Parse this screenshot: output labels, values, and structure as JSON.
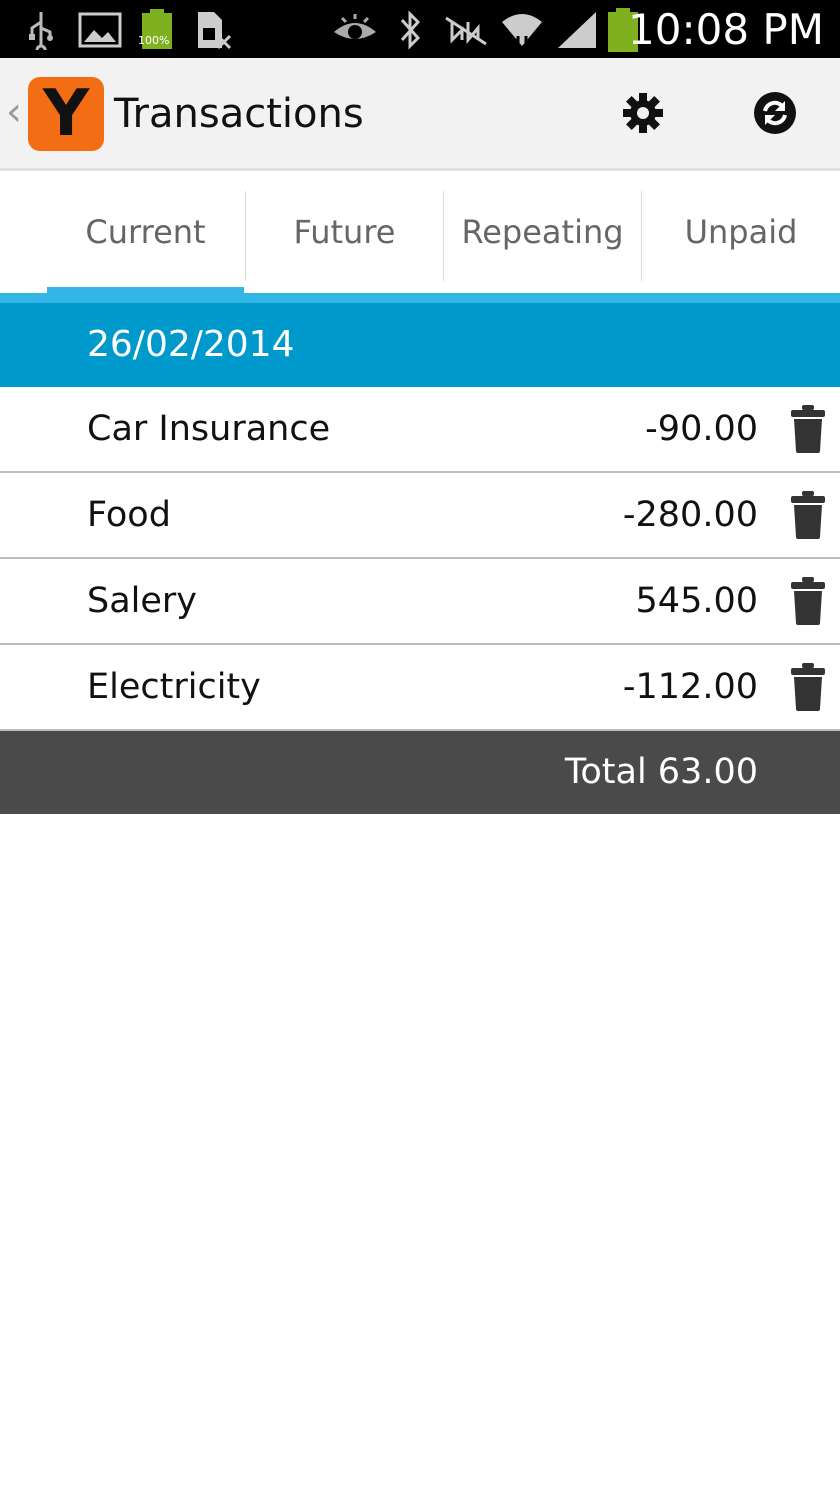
{
  "status_bar": {
    "time": "10:08 PM",
    "battery_label": "100%",
    "icons": [
      "usb-icon",
      "image-icon",
      "battery-full-icon",
      "sim-icon",
      "eye-icon",
      "bluetooth-icon",
      "nfc-muted-icon",
      "wifi-icon",
      "signal-icon",
      "battery-icon"
    ]
  },
  "action_bar": {
    "title": "Transactions",
    "logo_letter": "Y",
    "logo_color": "#f26d14",
    "settings_icon": "gear-icon",
    "refresh_icon": "refresh-icon"
  },
  "tabs": [
    {
      "label": "Current",
      "active": true
    },
    {
      "label": "Future",
      "active": false
    },
    {
      "label": "Repeating",
      "active": false
    },
    {
      "label": "Unpaid",
      "active": false
    }
  ],
  "accent_color": "#33b5e5",
  "date_header": "26/02/2014",
  "transactions": [
    {
      "name": "Car Insurance",
      "amount": "-90.00"
    },
    {
      "name": "Food",
      "amount": "-280.00"
    },
    {
      "name": "Salery",
      "amount": "545.00"
    },
    {
      "name": "Electricity",
      "amount": "-112.00"
    }
  ],
  "total_label": "Total 63.00"
}
